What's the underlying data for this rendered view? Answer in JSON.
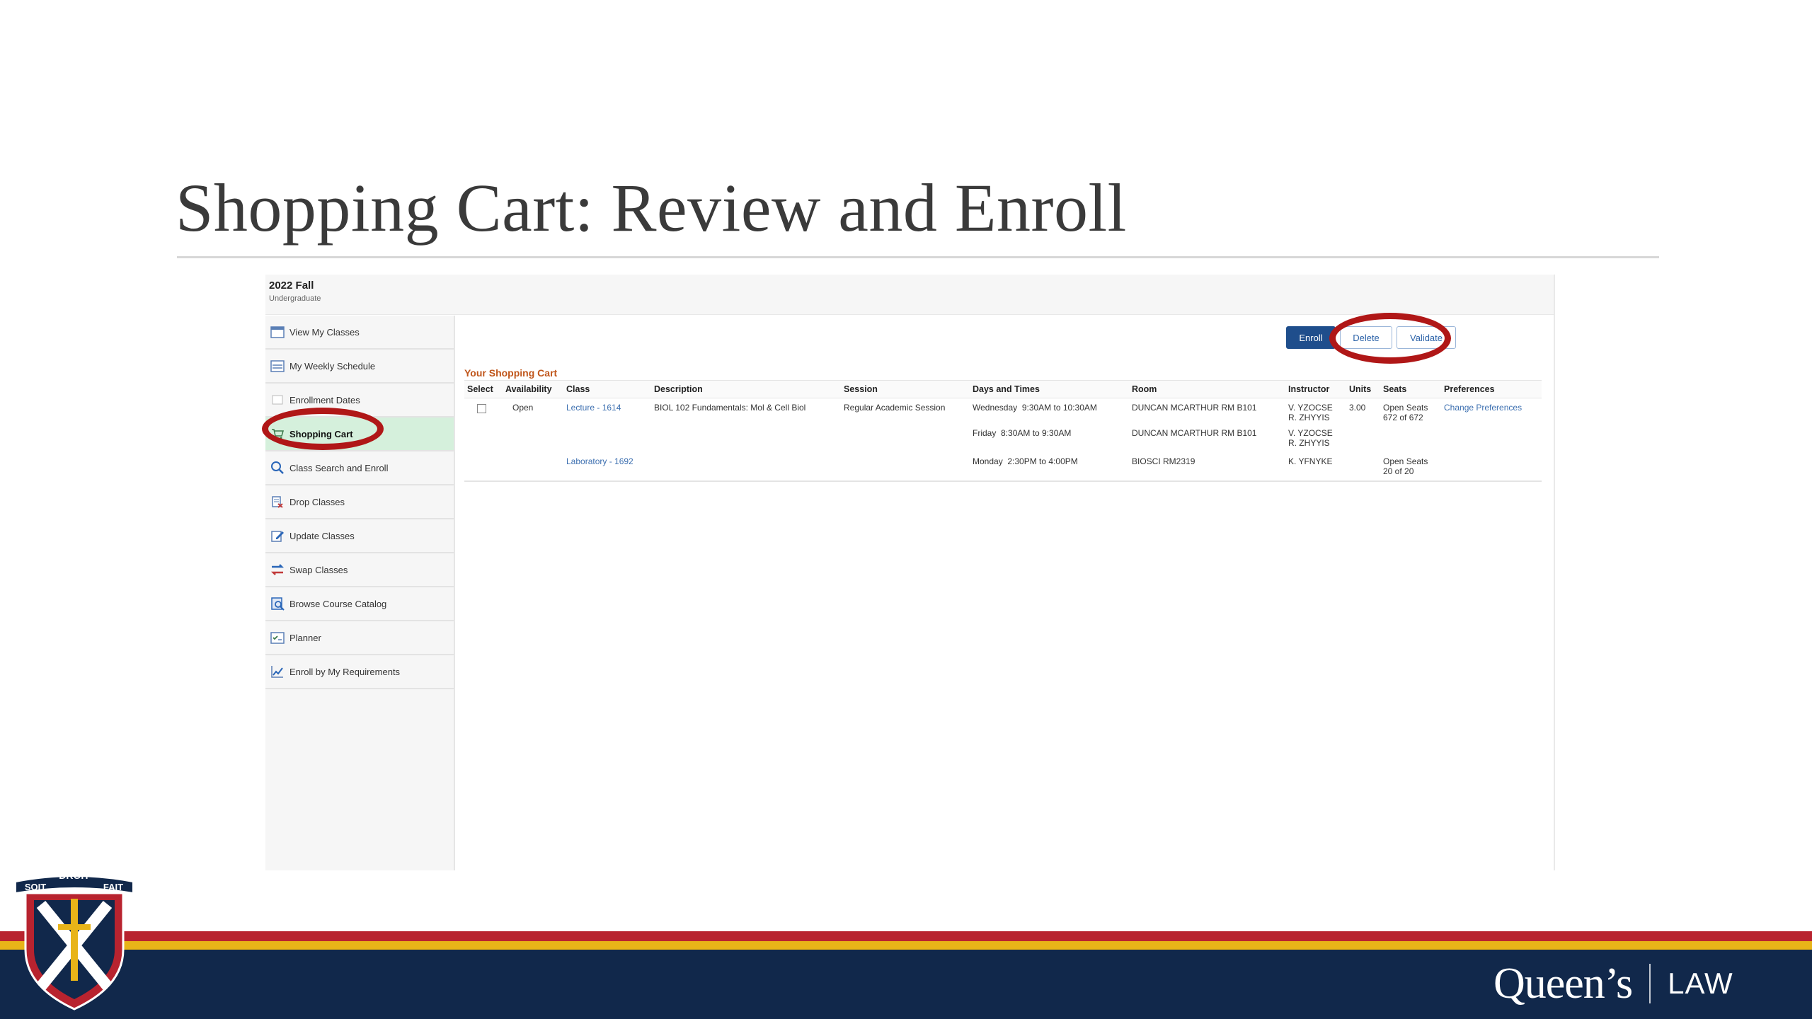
{
  "slide": {
    "title": "Shopping Cart: Review and Enroll"
  },
  "header": {
    "term": "2022 Fall",
    "career": "Undergraduate"
  },
  "sidebar": {
    "items": [
      {
        "label": "View My Classes",
        "icon": "calendar-icon"
      },
      {
        "label": "My Weekly Schedule",
        "icon": "weekly-schedule-icon"
      },
      {
        "label": "Enrollment Dates",
        "icon": "enrollment-dates-icon"
      },
      {
        "label": "Shopping Cart",
        "icon": "cart-icon",
        "active": true
      },
      {
        "label": "Class Search and Enroll",
        "icon": "search-icon"
      },
      {
        "label": "Drop Classes",
        "icon": "drop-icon"
      },
      {
        "label": "Update Classes",
        "icon": "edit-icon"
      },
      {
        "label": "Swap Classes",
        "icon": "swap-icon"
      },
      {
        "label": "Browse Course Catalog",
        "icon": "catalog-icon"
      },
      {
        "label": "Planner",
        "icon": "planner-icon"
      },
      {
        "label": "Enroll by My Requirements",
        "icon": "chart-icon"
      }
    ]
  },
  "toolbar": {
    "enroll_label": "Enroll",
    "delete_label": "Delete",
    "validate_label": "Validate"
  },
  "cart": {
    "label": "Your Shopping Cart",
    "columns": [
      "Select",
      "Availability",
      "Class",
      "Description",
      "Session",
      "Days and Times",
      "Room",
      "Instructor",
      "Units",
      "Seats",
      "Preferences"
    ],
    "row": {
      "availability": "Open",
      "description": "BIOL 102 Fundamentals: Mol & Cell Biol",
      "session": "Regular Academic Session",
      "units": "3.00",
      "preferences_link": "Change Preferences",
      "sections": [
        {
          "class": "Lecture - 1614",
          "meetings": [
            {
              "days_times": "Wednesday  9:30AM to 10:30AM",
              "room": "DUNCAN MCARTHUR RM B101",
              "instructor_1": "V. YZOCSE",
              "instructor_2": "R. ZHYYIS"
            },
            {
              "days_times": "Friday  8:30AM to 9:30AM",
              "room": "DUNCAN MCARTHUR RM B101",
              "instructor_1": "V. YZOCSE",
              "instructor_2": "R. ZHYYIS"
            }
          ],
          "seats_1": "Open Seats",
          "seats_2": "672 of 672"
        },
        {
          "class": "Laboratory - 1692",
          "meetings": [
            {
              "days_times": "Monday  2:30PM to 4:00PM",
              "room": "BIOSCI RM2319",
              "instructor_1": "K. YFNYKE"
            }
          ],
          "seats_1": "Open Seats",
          "seats_2": "20 of 20"
        }
      ]
    }
  },
  "footer": {
    "brand_name": "Queen’s",
    "brand_unit": "LAW",
    "crest_motto": [
      "SOIT",
      "DROIT",
      "FAIT"
    ],
    "colors": {
      "red": "#b8232f",
      "gold": "#e8b418",
      "navy": "#11284b"
    }
  },
  "highlight": {
    "color": "#b01717"
  }
}
